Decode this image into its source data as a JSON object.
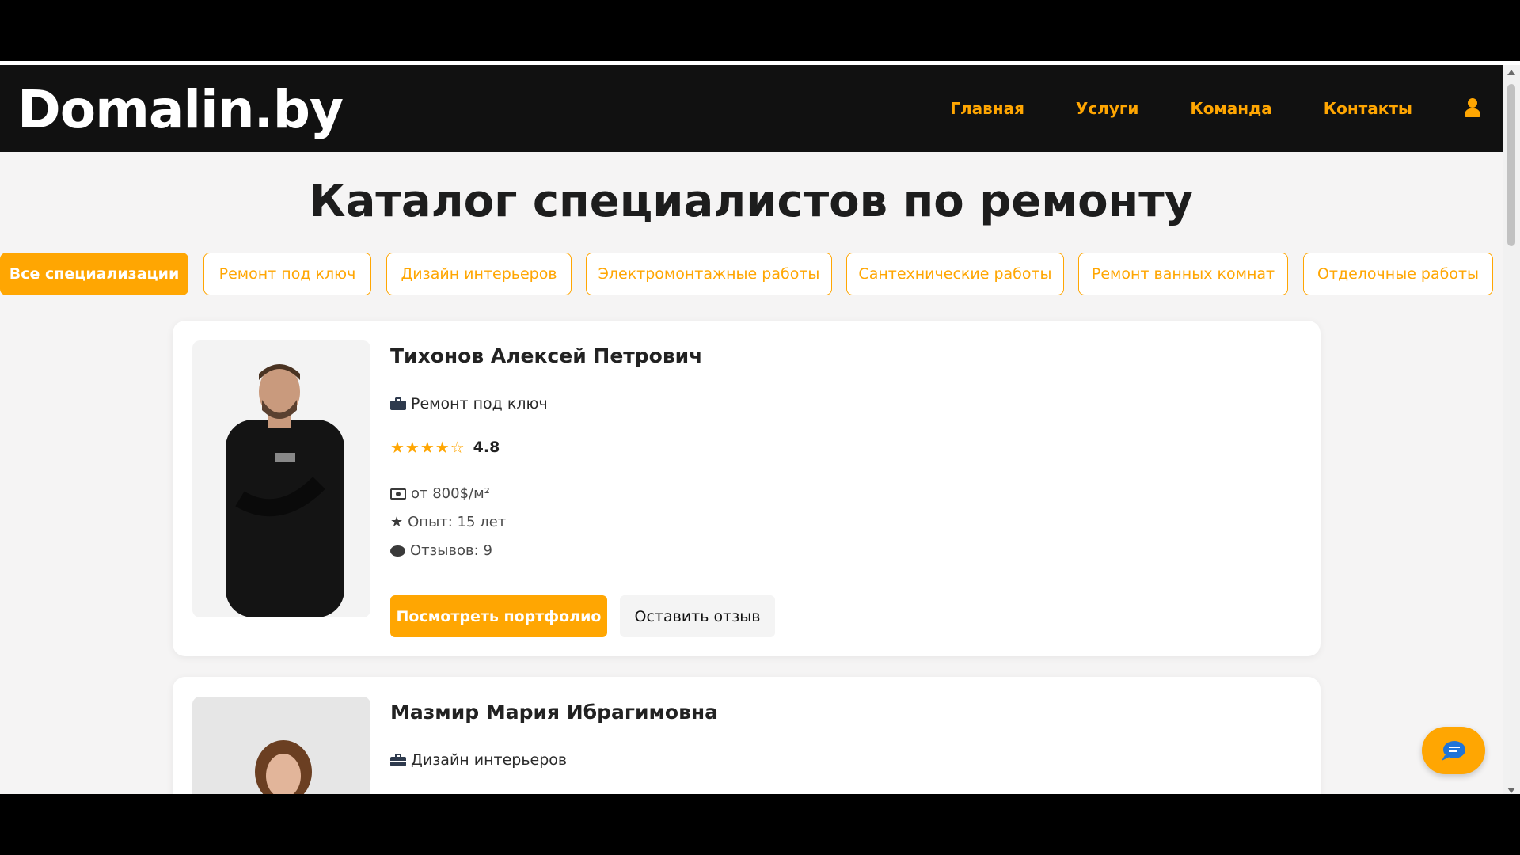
{
  "site": {
    "logo": "Domalin.by"
  },
  "nav": {
    "items": [
      "Главная",
      "Услуги",
      "Команда",
      "Контакты"
    ],
    "user_icon": "user-icon"
  },
  "page": {
    "title": "Каталог специалистов по ремонту"
  },
  "filters": [
    {
      "label": "Все специализации",
      "active": true
    },
    {
      "label": "Ремонт под ключ",
      "active": false
    },
    {
      "label": "Дизайн интерьеров",
      "active": false
    },
    {
      "label": "Электромонтажные работы",
      "active": false
    },
    {
      "label": "Сантехнические работы",
      "active": false
    },
    {
      "label": "Ремонт ванных комнат",
      "active": false
    },
    {
      "label": "Отделочные работы",
      "active": false
    }
  ],
  "specialists": [
    {
      "name": "Тихонов Алексей Петрович",
      "specialization": "Ремонт под ключ",
      "stars": "★★★★☆",
      "rating": "4.8",
      "price": "от 800$/м²",
      "experience": "Опыт: 15 лет",
      "reviews": "Отзывов: 9",
      "portfolio_button": "Посмотреть портфолио",
      "review_button": "Оставить отзыв"
    },
    {
      "name": "Мазмир Мария Ибрагимовна",
      "specialization": "Дизайн интерьеров"
    }
  ],
  "colors": {
    "accent": "#ffa602",
    "header_bg": "#111111",
    "page_bg": "#f5f4f4"
  }
}
